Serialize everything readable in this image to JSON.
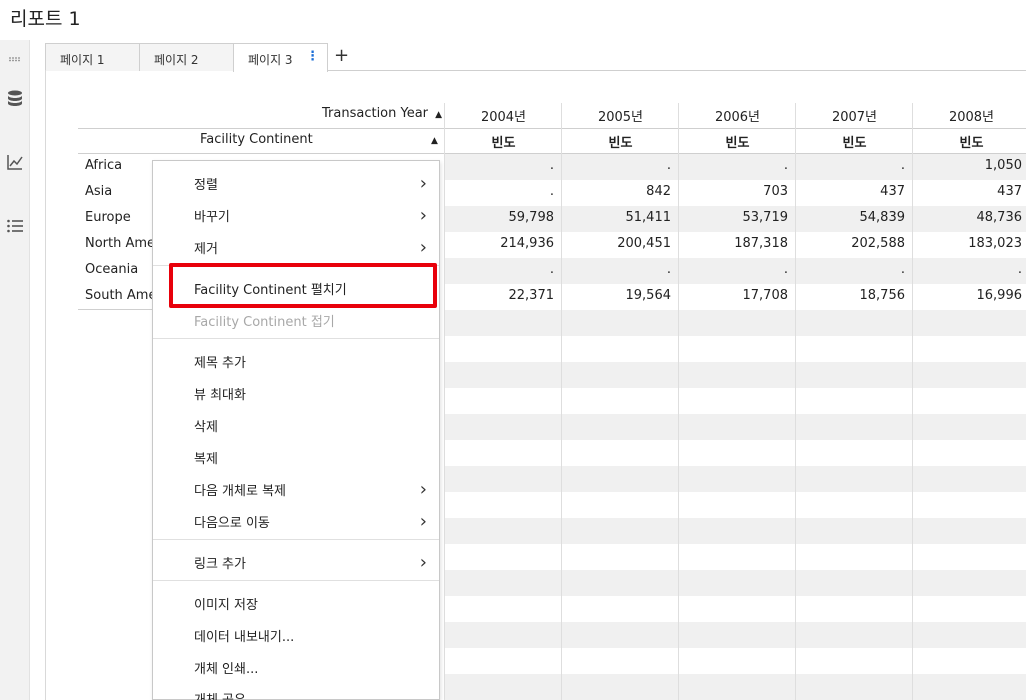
{
  "report": {
    "title": "리포트 1"
  },
  "side_rail": {
    "icons": [
      "grip-icon",
      "database-icon",
      "chart-line-icon",
      "list-icon"
    ]
  },
  "tabs": [
    {
      "label": "페이지 1",
      "active": false
    },
    {
      "label": "페이지 2",
      "active": false
    },
    {
      "label": "페이지 3",
      "active": true
    }
  ],
  "tab_menu_symbol": "⋮",
  "add_tab_symbol": "+",
  "crosstab": {
    "column_dimension": "Transaction Year",
    "row_dimension": "Facility Continent",
    "sort_arrow": "▲",
    "years": [
      "2004년",
      "2005년",
      "2006년",
      "2007년",
      "2008년"
    ],
    "measure_label": "빈도",
    "rows": [
      {
        "label": "Africa",
        "values": [
          ".",
          ".",
          ".",
          ".",
          "1,050"
        ]
      },
      {
        "label": "Asia",
        "values": [
          ".",
          "842",
          "703",
          "437",
          "437"
        ]
      },
      {
        "label": "Europe",
        "values": [
          "59,798",
          "51,411",
          "53,719",
          "54,839",
          "48,736"
        ]
      },
      {
        "label": "North America",
        "values": [
          "214,936",
          "200,451",
          "187,318",
          "202,588",
          "183,023"
        ]
      },
      {
        "label": "Oceania",
        "values": [
          ".",
          ".",
          ".",
          ".",
          "."
        ]
      },
      {
        "label": "South America",
        "values": [
          "22,371",
          "19,564",
          "17,708",
          "18,756",
          "16,996"
        ]
      }
    ]
  },
  "context_menu": {
    "sort": "정렬",
    "replace": "바꾸기",
    "remove": "제거",
    "expand": "Facility Continent 펼치기",
    "collapse": "Facility Continent 접기",
    "add_title": "제목 추가",
    "maximize_view": "뷰 최대화",
    "delete": "삭제",
    "duplicate": "복제",
    "duplicate_as": "다음 개체로 복제",
    "move_to": "다음으로 이동",
    "add_link": "링크 추가",
    "save_image": "이미지 저장",
    "export_data": "데이터 내보내기...",
    "print_object": "개체 인쇄...",
    "share_object": "개체 공유",
    "chevron": "›"
  },
  "colors": {
    "highlight": "#e8000a",
    "accent": "#1a6dd6",
    "band": "#f0f0f0"
  }
}
